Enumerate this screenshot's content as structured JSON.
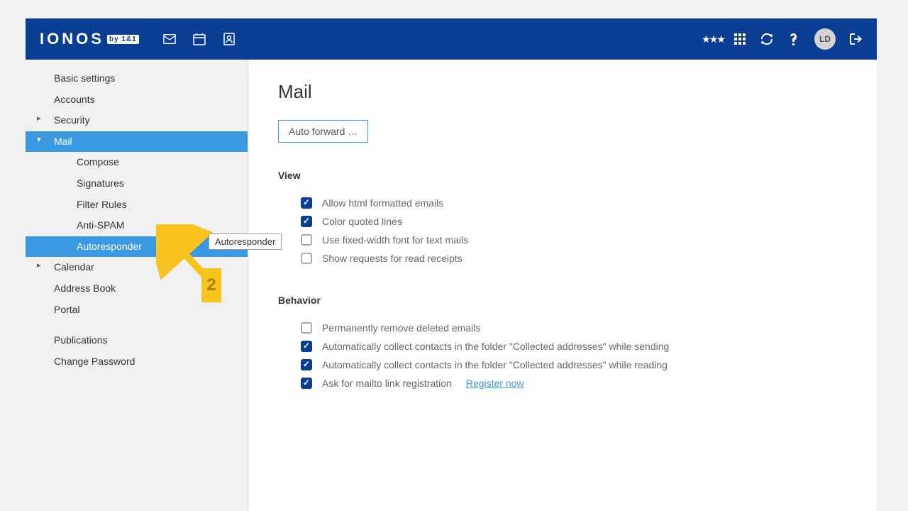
{
  "header": {
    "logo_text": "IONOS",
    "logo_sub": "by 1&1",
    "avatar_initials": "LD"
  },
  "sidebar": {
    "items": [
      {
        "label": "Basic settings",
        "level": 0,
        "caret": false
      },
      {
        "label": "Accounts",
        "level": 0,
        "caret": false
      },
      {
        "label": "Security",
        "level": 0,
        "caret": true
      },
      {
        "label": "Mail",
        "level": 0,
        "caret": true,
        "active_parent": true,
        "expanded": true
      },
      {
        "label": "Compose",
        "level": 1
      },
      {
        "label": "Signatures",
        "level": 1
      },
      {
        "label": "Filter Rules",
        "level": 1
      },
      {
        "label": "Anti-SPAM",
        "level": 1
      },
      {
        "label": "Autoresponder",
        "level": 1,
        "active_child": true
      },
      {
        "label": "Calendar",
        "level": 0,
        "caret": true
      },
      {
        "label": "Address Book",
        "level": 0,
        "caret": false
      },
      {
        "label": "Portal",
        "level": 0,
        "caret": false
      },
      {
        "gap": true
      },
      {
        "label": "Publications",
        "level": 0,
        "caret": false
      },
      {
        "label": "Change Password",
        "level": 0,
        "caret": false
      }
    ]
  },
  "content": {
    "title": "Mail",
    "autoforward_label": "Auto forward …",
    "view": {
      "heading": "View",
      "options": [
        {
          "label": "Allow html formatted emails",
          "checked": true
        },
        {
          "label": "Color quoted lines",
          "checked": true
        },
        {
          "label": "Use fixed-width font for text mails",
          "checked": false
        },
        {
          "label": "Show requests for read receipts",
          "checked": false
        }
      ]
    },
    "behavior": {
      "heading": "Behavior",
      "options": [
        {
          "label": "Permanently remove deleted emails",
          "checked": false
        },
        {
          "label": "Automatically collect contacts in the folder \"Collected addresses\" while sending",
          "checked": true
        },
        {
          "label": "Automatically collect contacts in the folder \"Collected addresses\" while reading",
          "checked": true
        },
        {
          "label": "Ask for mailto link registration",
          "checked": true,
          "link": "Register now"
        }
      ]
    }
  },
  "annotation": {
    "tooltip": "Autoresponder",
    "step": "2"
  }
}
